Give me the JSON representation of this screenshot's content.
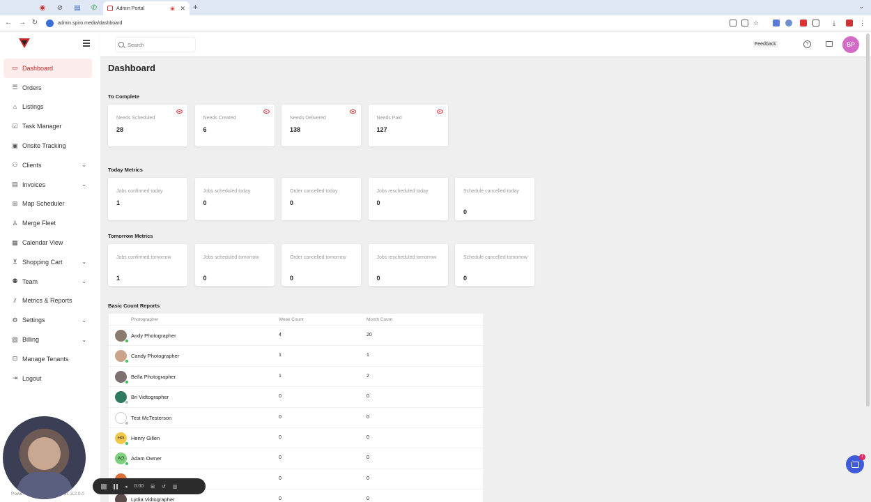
{
  "browser": {
    "tab_title": "Admin Portal",
    "url": "admin.spiro.media/dashboard"
  },
  "sidebar": {
    "items": [
      {
        "label": "Dashboard",
        "icon": "monitor-icon",
        "active": true
      },
      {
        "label": "Orders",
        "icon": "orders-icon"
      },
      {
        "label": "Listings",
        "icon": "house-icon"
      },
      {
        "label": "Task Manager",
        "icon": "checkbox-icon"
      },
      {
        "label": "Onsite Tracking",
        "icon": "video-icon"
      },
      {
        "label": "Clients",
        "icon": "users-icon",
        "expandable": true
      },
      {
        "label": "Invoices",
        "icon": "invoice-icon",
        "expandable": true
      },
      {
        "label": "Map Scheduler",
        "icon": "map-icon"
      },
      {
        "label": "Merge Fleet",
        "icon": "person-icon"
      },
      {
        "label": "Calendar View",
        "icon": "calendar-icon"
      },
      {
        "label": "Shopping Cart",
        "icon": "cart-icon",
        "expandable": true
      },
      {
        "label": "Team",
        "icon": "team-icon",
        "expandable": true
      },
      {
        "label": "Metrics & Reports",
        "icon": "chart-icon"
      },
      {
        "label": "Settings",
        "icon": "gear-icon",
        "expandable": true
      },
      {
        "label": "Billing",
        "icon": "billing-icon",
        "expandable": true
      },
      {
        "label": "Manage Tenants",
        "icon": "tenants-icon"
      },
      {
        "label": "Logout",
        "icon": "logout-icon"
      }
    ],
    "version": "Ver. 3.2.0.0",
    "powered": "Powe"
  },
  "header": {
    "search_placeholder": "Search",
    "feedback": "Feedback",
    "user_initials": "BP",
    "help": "?"
  },
  "main": {
    "title": "Dashboard",
    "to_complete": {
      "title": "To Complete",
      "cards": [
        {
          "label": "Needs Scheduled",
          "value": "28"
        },
        {
          "label": "Needs Created",
          "value": "6"
        },
        {
          "label": "Needs Delivered",
          "value": "138"
        },
        {
          "label": "Needs Paid",
          "value": "127"
        }
      ]
    },
    "today": {
      "title": "Today Metrics",
      "cards": [
        {
          "label": "Jobs confirmed today",
          "value": "1"
        },
        {
          "label": "Jobs scheduled today",
          "value": "0"
        },
        {
          "label": "Order cancelled today",
          "value": "0"
        },
        {
          "label": "Jobs rescheduled today",
          "value": "0"
        },
        {
          "label": "Schedule cancelled today",
          "value": "0"
        }
      ]
    },
    "tomorrow": {
      "title": "Tomorrow Metrics",
      "cards": [
        {
          "label": "Jobs confirmed tomorrow",
          "value": "1"
        },
        {
          "label": "Jobs scheduled tomorrow",
          "value": "0"
        },
        {
          "label": "Order cancelled tomorrow",
          "value": "0"
        },
        {
          "label": "Jobs rescheduled tomorrow",
          "value": "0"
        },
        {
          "label": "Schedule cancelled tomorrow",
          "value": "0"
        }
      ]
    },
    "report": {
      "title": "Basic Count Reports",
      "columns": [
        "Photographer",
        "Week Count",
        "Month Count"
      ],
      "rows": [
        {
          "name": "Andy Photographer",
          "week": "4",
          "month": "20",
          "avatar": "",
          "avatar_color": "#8a7b6e",
          "online": true
        },
        {
          "name": "Candy Photographer",
          "week": "1",
          "month": "1",
          "avatar": "",
          "avatar_color": "#c9a48a",
          "online": true
        },
        {
          "name": "Bella Photographer",
          "week": "1",
          "month": "2",
          "avatar": "",
          "avatar_color": "#7d7070",
          "online": true
        },
        {
          "name": "Bri Vidtographer",
          "week": "0",
          "month": "0",
          "avatar": "",
          "avatar_color": "#2f7a5e",
          "online": false
        },
        {
          "name": "Test McTesterson",
          "week": "0",
          "month": "0",
          "avatar": "",
          "avatar_color": "#ffffff",
          "online": false
        },
        {
          "name": "Henry Gillen",
          "week": "0",
          "month": "0",
          "avatar": "HG",
          "avatar_color": "#f2c84b",
          "online": true
        },
        {
          "name": "Adam Owner",
          "week": "0",
          "month": "0",
          "avatar": "AO",
          "avatar_color": "#7ed07e",
          "online": true
        },
        {
          "name": "",
          "week": "0",
          "month": "0",
          "avatar": "",
          "avatar_color": "#d9703a",
          "online": false
        },
        {
          "name": "Lydia Vidtographer",
          "week": "0",
          "month": "0",
          "avatar": "",
          "avatar_color": "#5b4b4b",
          "online": false
        }
      ]
    }
  },
  "recorder": {
    "time": "0:00"
  },
  "chat": {
    "badge": "1"
  },
  "colors": {
    "accent": "#c62828",
    "avatar": "#d36bc6",
    "online": "#3fbf5a",
    "chat": "#3f5bd9"
  }
}
